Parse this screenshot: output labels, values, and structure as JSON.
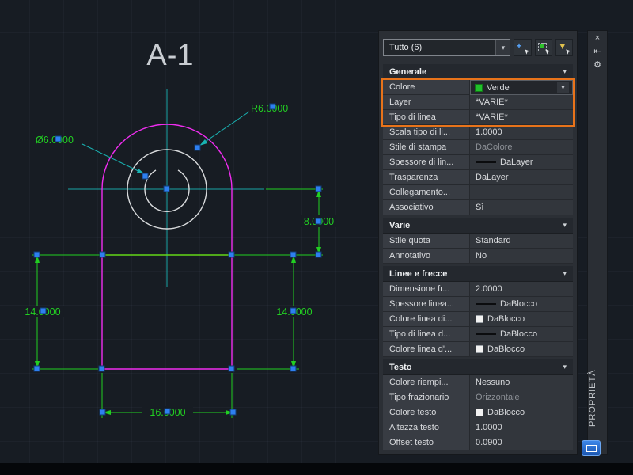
{
  "canvas": {
    "title": "A-1",
    "dims": {
      "radius_label": "R6.0000",
      "diameter_label": "Ø6.0000",
      "right_height": "8.0000",
      "left_side": "14.0000",
      "right_side": "14.0000",
      "bottom_width": "16.0000"
    },
    "colors": {
      "dimension_green": "#22cf22",
      "centerline_teal": "#18a5a5",
      "outline_magenta": "#f02df0",
      "selected_line_yellow": "#e8e800",
      "grip_blue": "#2e7ff0",
      "geometry_white": "#d9dbdd"
    }
  },
  "panel": {
    "selector_value": "Tutto (6)",
    "title": "PROPRIETÀ",
    "highlight_color": "#e8731a",
    "icons": {
      "chevron": "▾",
      "close": "×",
      "autohide": "⇤",
      "gear": "⚙",
      "cursor": "➤",
      "pickadd_plus": "+",
      "funnel": "▼"
    },
    "sections": [
      {
        "title": "Generale",
        "rows": [
          {
            "label": "Colore",
            "value": "Verde"
          },
          {
            "label": "Layer",
            "value": "*VARIE*"
          },
          {
            "label": "Tipo di linea",
            "value": "*VARIE*"
          },
          {
            "label": "Scala tipo di li...",
            "value": "1.0000"
          },
          {
            "label": "Stile di stampa",
            "value": "DaColore"
          },
          {
            "label": "Spessore di lin...",
            "value": "DaLayer"
          },
          {
            "label": "Trasparenza",
            "value": "DaLayer"
          },
          {
            "label": "Collegamento...",
            "value": ""
          },
          {
            "label": "Associativo",
            "value": "Sì"
          }
        ]
      },
      {
        "title": "Varie",
        "rows": [
          {
            "label": "Stile quota",
            "value": "Standard"
          },
          {
            "label": "Annotativo",
            "value": "No"
          }
        ]
      },
      {
        "title": "Linee e frecce",
        "rows": [
          {
            "label": "Dimensione fr...",
            "value": "2.0000"
          },
          {
            "label": "Spessore  linea...",
            "value": "DaBlocco"
          },
          {
            "label": "Colore linea di...",
            "value": "DaBlocco"
          },
          {
            "label": "Tipo di linea d...",
            "value": "DaBlocco"
          },
          {
            "label": "Colore linea d'...",
            "value": "DaBlocco"
          }
        ]
      },
      {
        "title": "Testo",
        "rows": [
          {
            "label": "Colore riempi...",
            "value": "Nessuno"
          },
          {
            "label": "Tipo frazionario",
            "value": "Orizzontale"
          },
          {
            "label": "Colore testo",
            "value": "DaBlocco"
          },
          {
            "label": "Altezza testo",
            "value": "1.0000"
          },
          {
            "label": "Offset testo",
            "value": "0.0900"
          }
        ]
      }
    ]
  }
}
